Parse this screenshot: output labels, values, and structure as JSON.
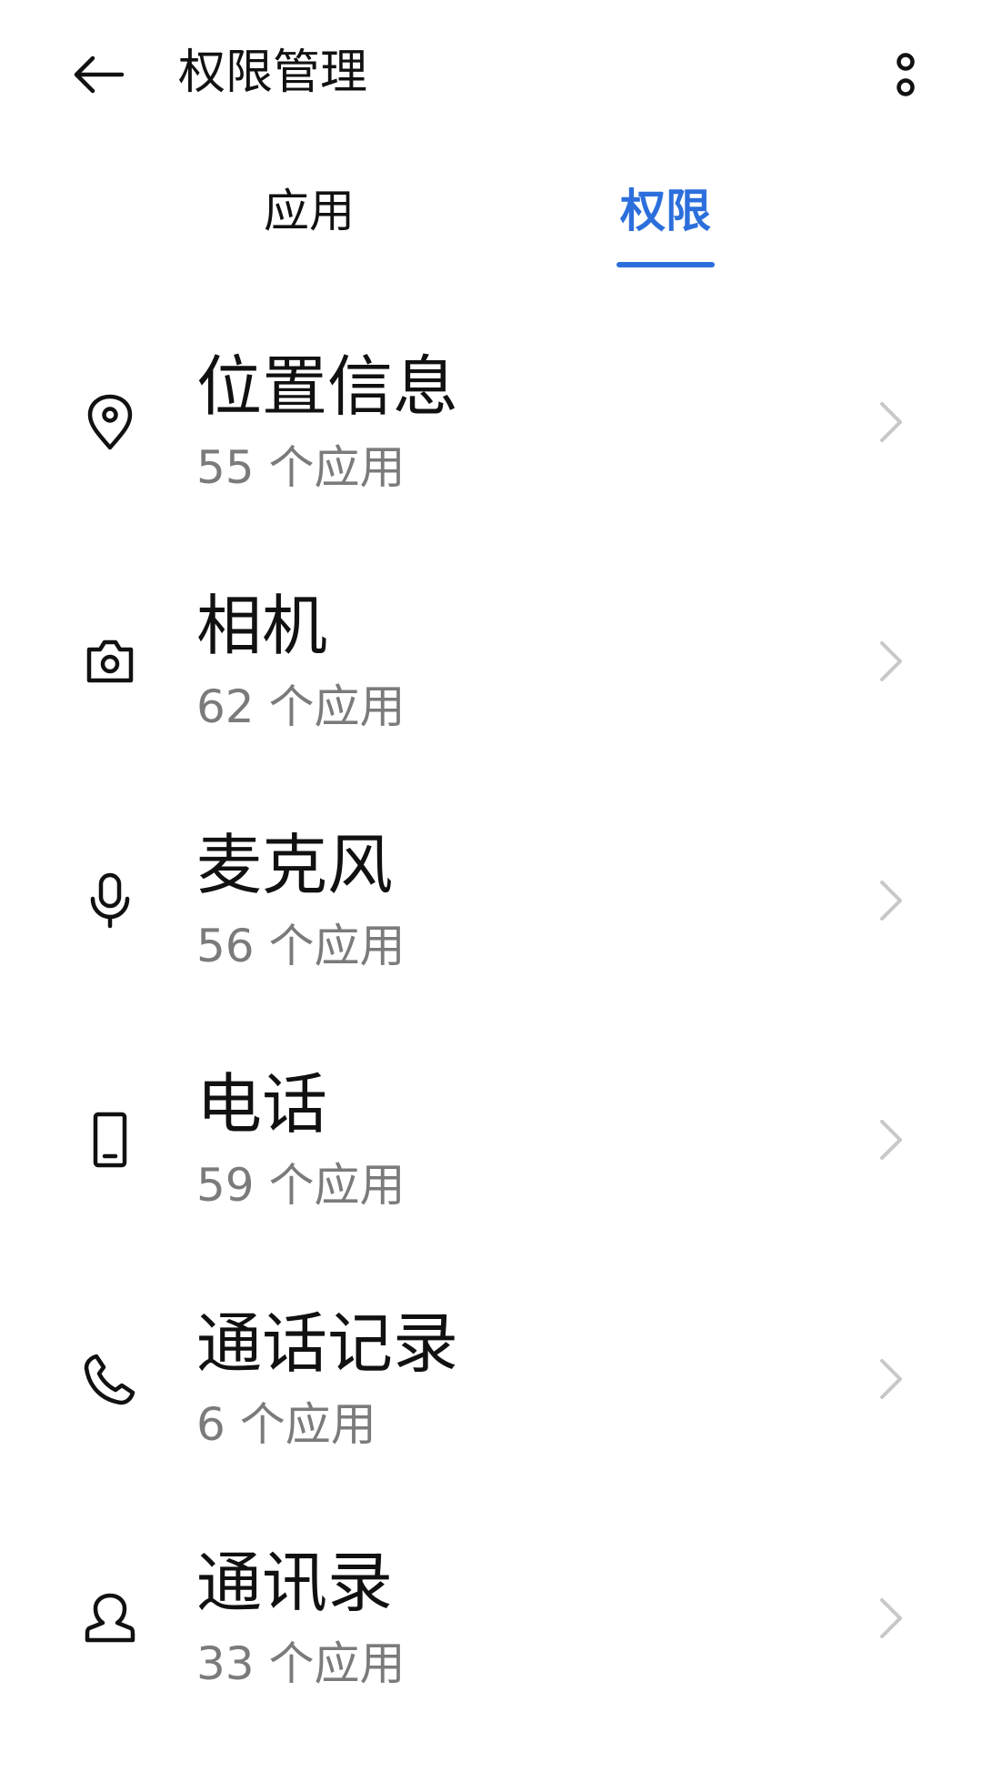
{
  "header": {
    "title": "权限管理",
    "back_icon": "arrow-left-icon",
    "more_icon": "more-vertical-icon"
  },
  "tabs": [
    {
      "label": "应用",
      "active": false
    },
    {
      "label": "权限",
      "active": true
    }
  ],
  "colors": {
    "accent": "#2c6fdc",
    "text_primary": "#111111",
    "text_secondary": "#7b7b7b",
    "chevron": "#c8c8c8"
  },
  "permissions": [
    {
      "label": "位置信息",
      "count_text": "55 个应用",
      "icon": "location-pin-icon"
    },
    {
      "label": "相机",
      "count_text": "62 个应用",
      "icon": "camera-icon"
    },
    {
      "label": "麦克风",
      "count_text": "56 个应用",
      "icon": "microphone-icon"
    },
    {
      "label": "电话",
      "count_text": "59 个应用",
      "icon": "phone-device-icon"
    },
    {
      "label": "通话记录",
      "count_text": "6 个应用",
      "icon": "call-log-icon"
    },
    {
      "label": "通讯录",
      "count_text": "33 个应用",
      "icon": "contacts-icon"
    }
  ]
}
